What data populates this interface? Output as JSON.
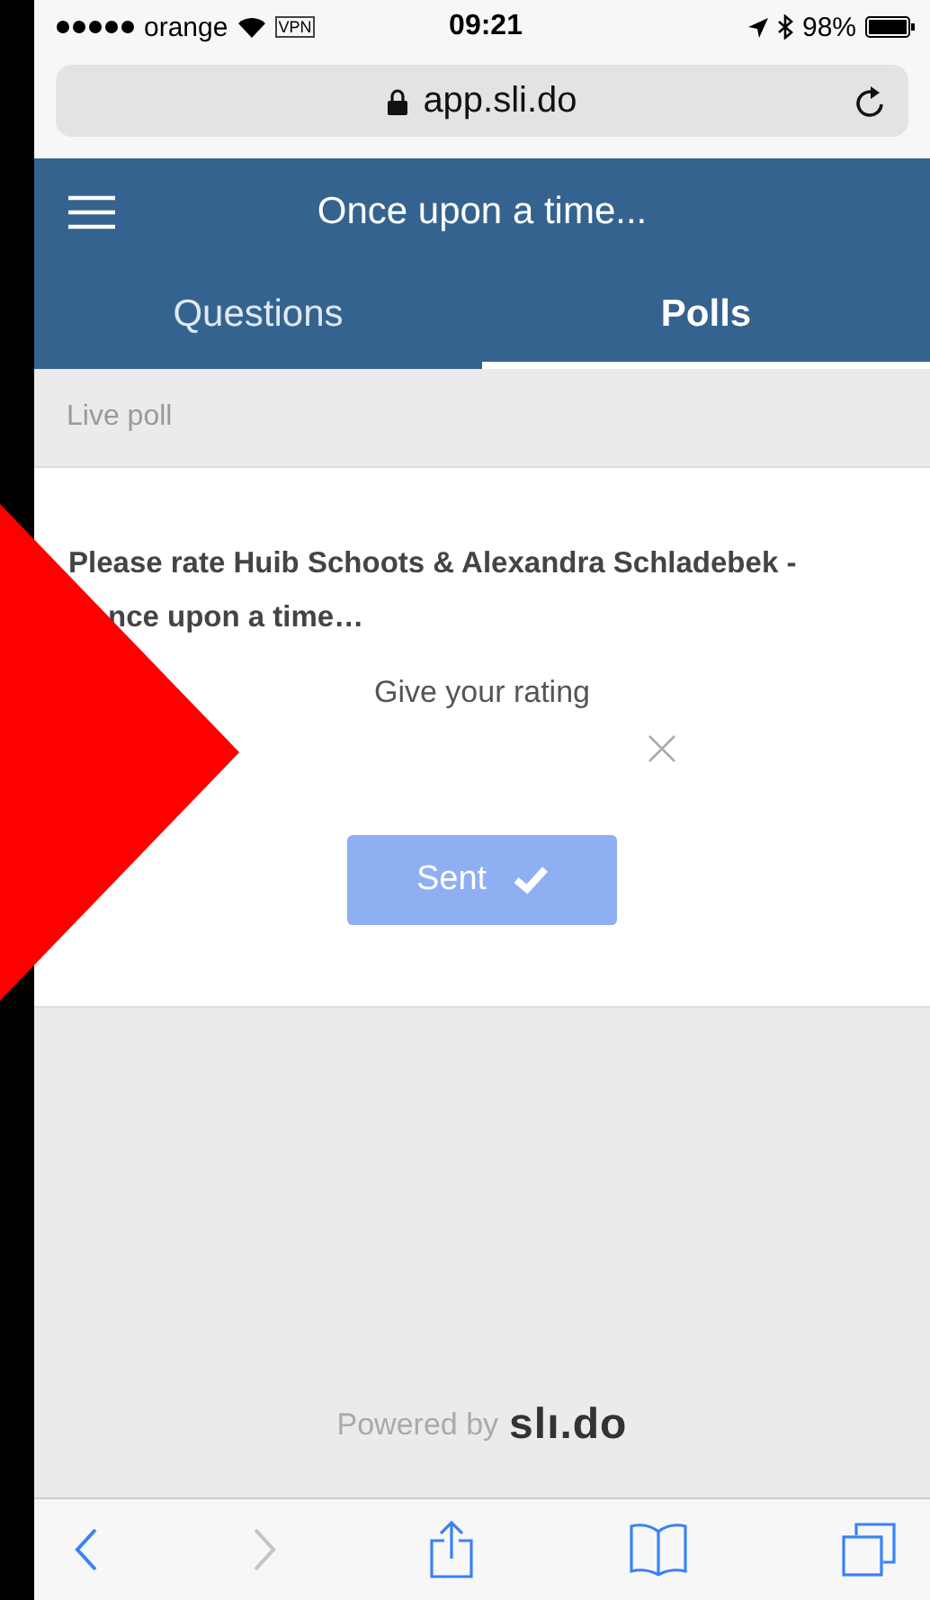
{
  "status_bar": {
    "carrier": "orange",
    "vpn": "VPN",
    "time": "09:21",
    "battery": "98%"
  },
  "address_bar": {
    "url": "app.sli.do"
  },
  "header": {
    "title": "Once upon a time..."
  },
  "tabs": [
    {
      "label": "Questions",
      "selected": false
    },
    {
      "label": "Polls",
      "selected": true
    }
  ],
  "section_label": "Live poll",
  "poll": {
    "question_line_1": "Please rate Huib Schoots & Alexandra Schladebek -",
    "question_line_2": "nce upon a time…",
    "prompt": "Give your rating",
    "button": {
      "label": "Sent",
      "disabled": true
    }
  },
  "footer": {
    "powered_by": "Powered by",
    "logo": "slı.do"
  },
  "toolbar": [
    {
      "kind": "back",
      "disabled": false
    },
    {
      "kind": "forward",
      "disabled": true
    },
    {
      "kind": "share",
      "disabled": false
    },
    {
      "kind": "bookmarks",
      "disabled": false
    },
    {
      "kind": "tabs",
      "disabled": false
    }
  ]
}
